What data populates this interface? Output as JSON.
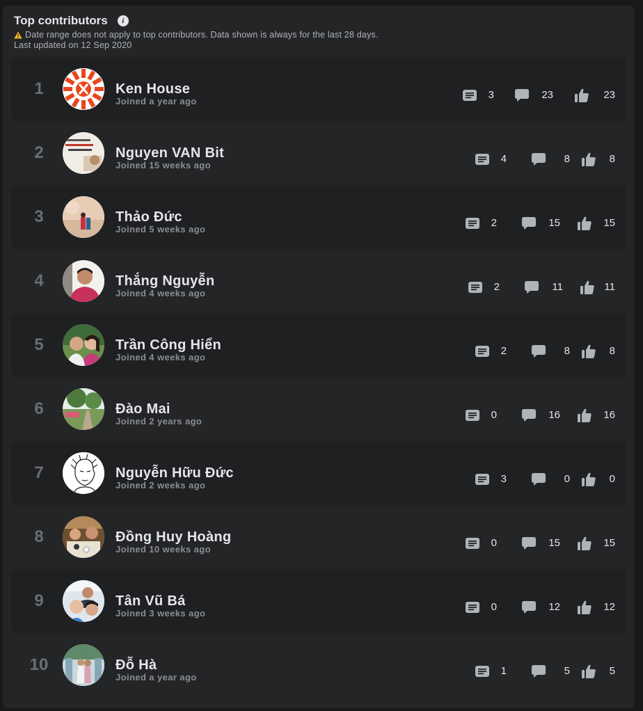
{
  "header": {
    "title": "Top contributors",
    "note": "Date range does not apply to top contributors. Data shown is always for the last 28 days.",
    "updated": "Last updated on 12 Sep 2020"
  },
  "icons": {
    "posts": "post-icon",
    "comments": "comment-icon",
    "reactions": "like-icon",
    "warning": "warning-icon",
    "info": "info-icon"
  },
  "colors": {
    "background": "#18191a",
    "panel": "#242526",
    "text": "#e4e6eb",
    "muted": "#8a8d91",
    "warning": "#f7b928"
  },
  "contributors": [
    {
      "rank": "1",
      "name": "Ken House",
      "joined": "Joined a year ago",
      "posts": "3",
      "comments": "23",
      "reactions": "23"
    },
    {
      "rank": "2",
      "name": "Nguyen VAN Bit",
      "joined": "Joined 15 weeks ago",
      "posts": "4",
      "comments": "8",
      "reactions": "8"
    },
    {
      "rank": "3",
      "name": "Thảo Đức",
      "joined": "Joined 5 weeks ago",
      "posts": "2",
      "comments": "15",
      "reactions": "15"
    },
    {
      "rank": "4",
      "name": "Thắng Nguyễn",
      "joined": "Joined 4 weeks ago",
      "posts": "2",
      "comments": "11",
      "reactions": "11"
    },
    {
      "rank": "5",
      "name": "Trần Công Hiển",
      "joined": "Joined 4 weeks ago",
      "posts": "2",
      "comments": "8",
      "reactions": "8"
    },
    {
      "rank": "6",
      "name": "Đào Mai",
      "joined": "Joined 2 years ago",
      "posts": "0",
      "comments": "16",
      "reactions": "16"
    },
    {
      "rank": "7",
      "name": "Nguyễn Hữu Đức",
      "joined": "Joined 2 weeks ago",
      "posts": "3",
      "comments": "0",
      "reactions": "0"
    },
    {
      "rank": "8",
      "name": "Đồng Huy Hoàng",
      "joined": "Joined 10 weeks ago",
      "posts": "0",
      "comments": "15",
      "reactions": "15"
    },
    {
      "rank": "9",
      "name": "Tân Vũ Bá",
      "joined": "Joined 3 weeks ago",
      "posts": "0",
      "comments": "12",
      "reactions": "12"
    },
    {
      "rank": "10",
      "name": "Đỗ Hà",
      "joined": "Joined a year ago",
      "posts": "1",
      "comments": "5",
      "reactions": "5"
    }
  ]
}
